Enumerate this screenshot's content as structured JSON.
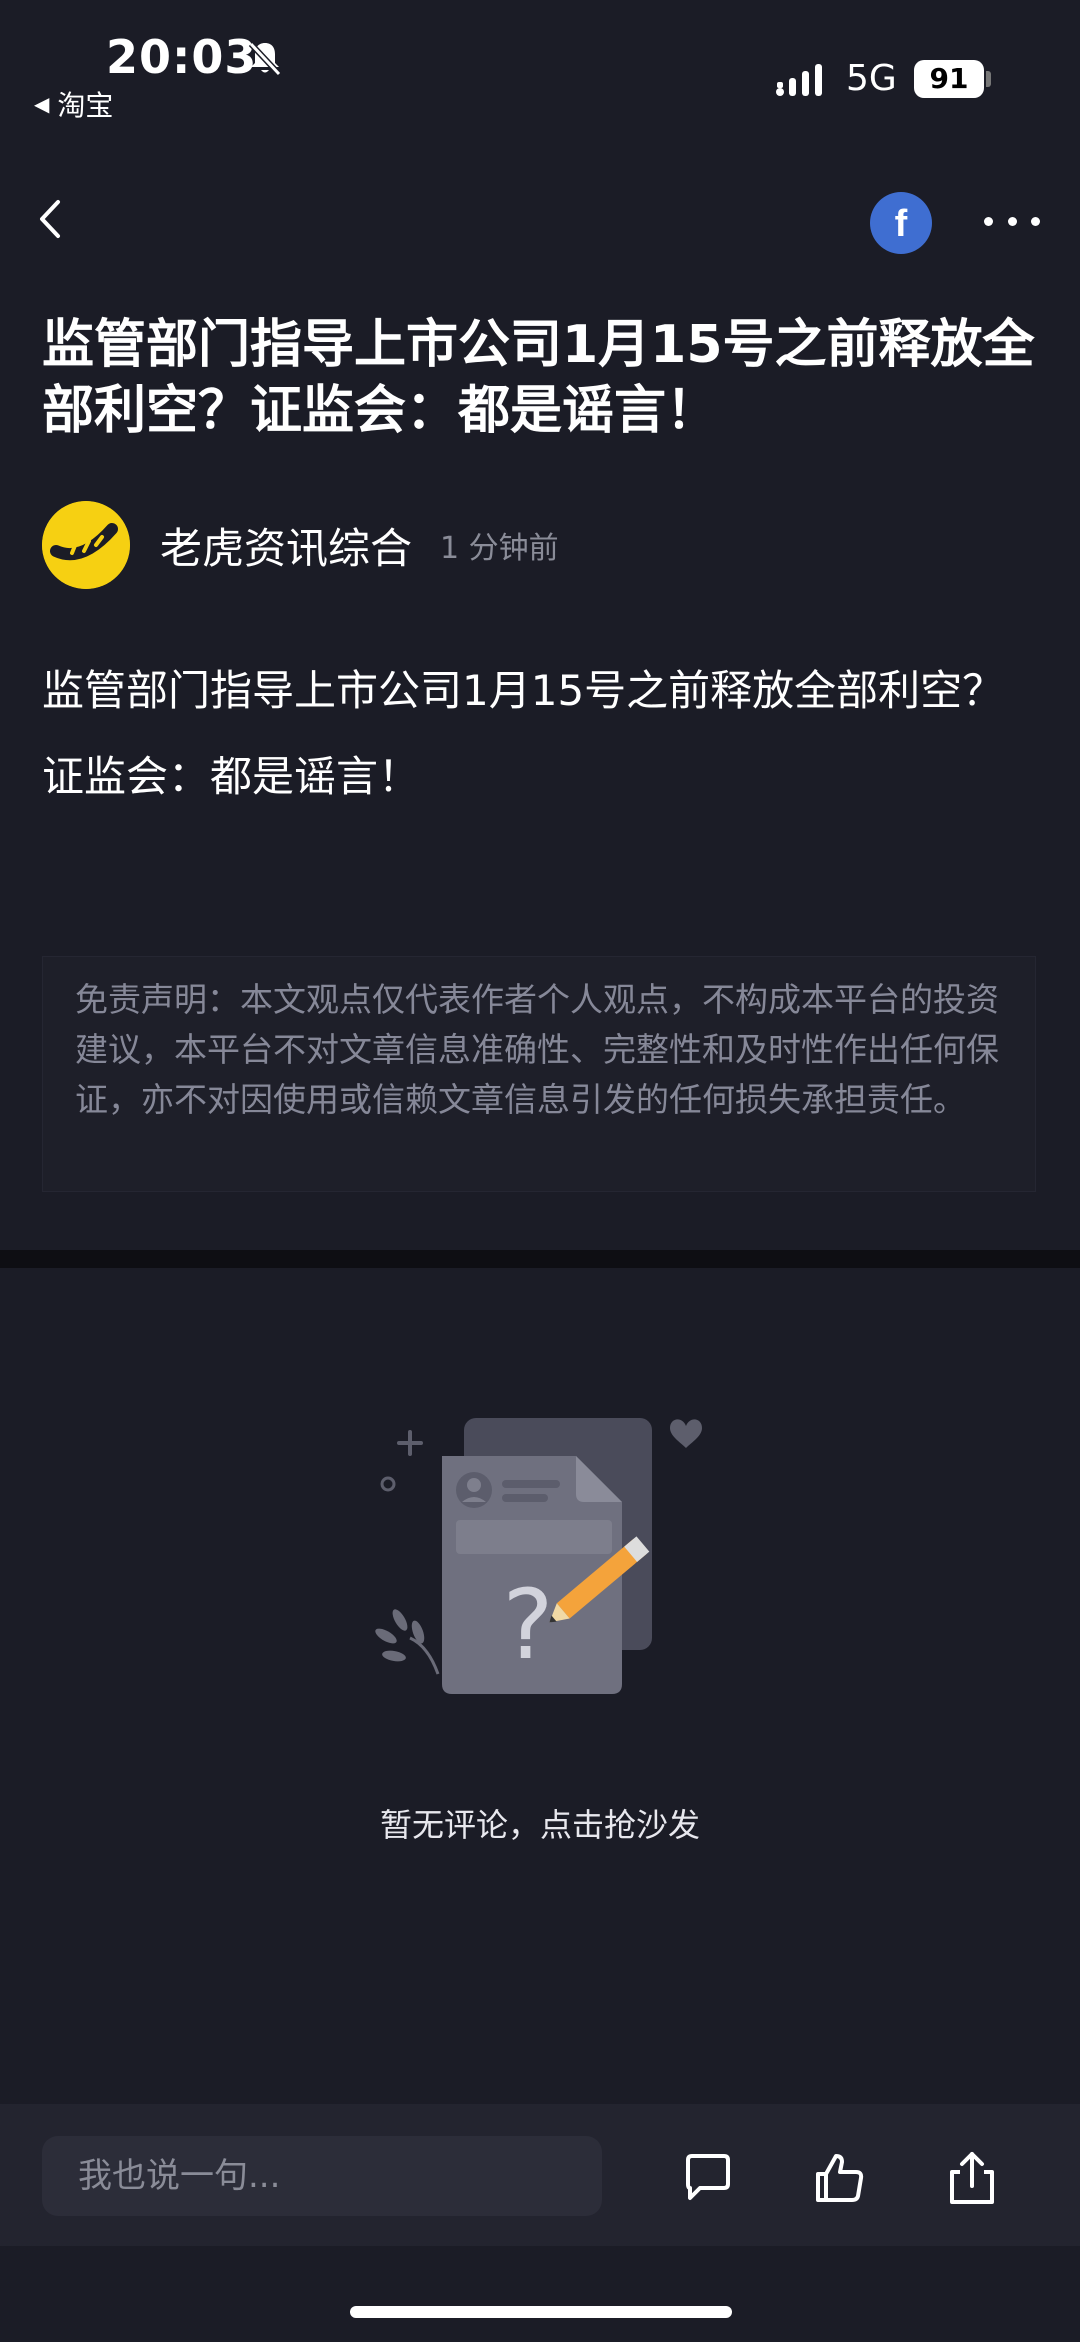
{
  "status_bar": {
    "time": "20:03",
    "back_app": "淘宝",
    "network": "5G",
    "battery": "91"
  },
  "article": {
    "title": "监管部门指导上市公司1月15号之前释放全部利空？证监会：都是谣言！",
    "author": "老虎资讯综合",
    "time_ago": "1 分钟前",
    "body": "监管部门指导上市公司1月15号之前释放全部利空？证监会：都是谣言！",
    "disclaimer": "免责声明：本文观点仅代表作者个人观点，不构成本平台的投资建议，本平台不对文章信息准确性、完整性和及时性作出任何保证，亦不对因使用或信赖文章信息引发的任何损失承担责任。"
  },
  "comments": {
    "empty_text": "暂无评论，点击抢沙发"
  },
  "bottom_bar": {
    "input_placeholder": "我也说一句..."
  },
  "icons": {
    "brand_fb": "facebook-icon",
    "accent": "#3f6ed1",
    "avatar_bg": "#f6d012"
  }
}
